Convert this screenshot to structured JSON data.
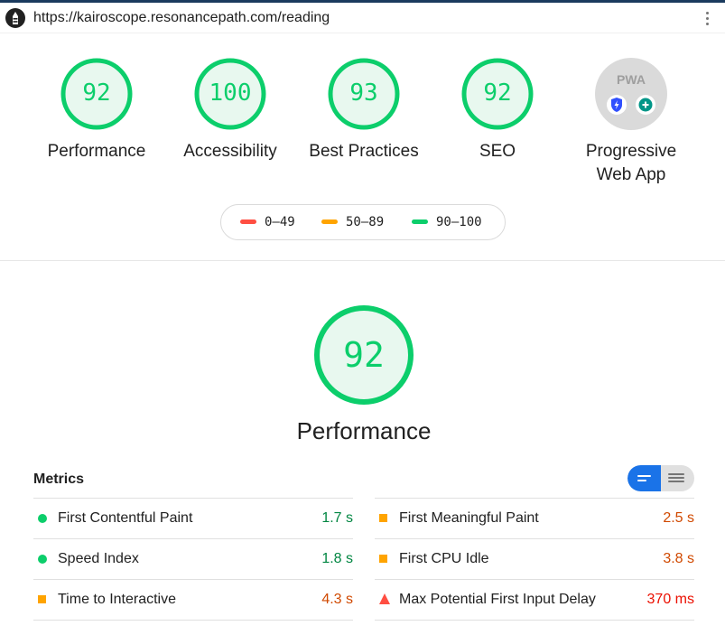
{
  "browser": {
    "url": "https://kairoscope.resonancepath.com/reading"
  },
  "colors": {
    "pass": "#0cce6b",
    "average": "#ffa400",
    "fail": "#ff4e42",
    "accent": "#1a73e8"
  },
  "categories": [
    {
      "label": "Performance",
      "score": "92"
    },
    {
      "label": "Accessibility",
      "score": "100"
    },
    {
      "label": "Best Practices",
      "score": "93"
    },
    {
      "label": "SEO",
      "score": "92"
    }
  ],
  "pwa": {
    "badge_text": "PWA",
    "label_line1": "Progressive",
    "label_line2": "Web App",
    "icons": [
      "lightning-shield-icon",
      "plus-circle-icon"
    ]
  },
  "legend": [
    {
      "range": "0–49",
      "status": "fail"
    },
    {
      "range": "50–89",
      "status": "average"
    },
    {
      "range": "90–100",
      "status": "pass"
    }
  ],
  "performance_section": {
    "score": "92",
    "title": "Performance",
    "metrics_title": "Metrics",
    "view_toggle": {
      "selected": "compact",
      "icons": [
        "compact-view-icon",
        "expanded-view-icon"
      ]
    }
  },
  "metrics": {
    "left": [
      {
        "name": "First Contentful Paint",
        "value": "1.7 s",
        "status": "pass"
      },
      {
        "name": "Speed Index",
        "value": "1.8 s",
        "status": "pass"
      },
      {
        "name": "Time to Interactive",
        "value": "4.3 s",
        "status": "average"
      }
    ],
    "right": [
      {
        "name": "First Meaningful Paint",
        "value": "2.5 s",
        "status": "average"
      },
      {
        "name": "First CPU Idle",
        "value": "3.8 s",
        "status": "average"
      },
      {
        "name": "Max Potential First Input Delay",
        "value": "370 ms",
        "status": "fail"
      }
    ]
  }
}
